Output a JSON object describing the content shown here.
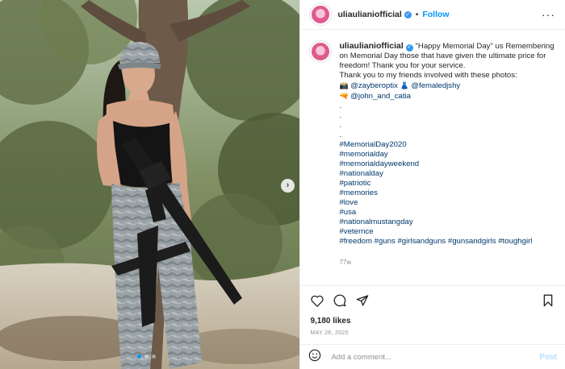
{
  "header": {
    "username": "uliaulianiofficial",
    "separator": "•",
    "follow_label": "Follow",
    "more_label": "···"
  },
  "caption": {
    "username": "uliaulianiofficial",
    "lines": [
      "\"Happy Memorial Day\" us Remembering on Memorial Day those that have given the ultimate price for freedom! Thank you for your service.",
      "Thank you to my friends involved with these photos:"
    ],
    "credit1_prefix_icon": "📸",
    "credit1_user1": "@zayberoptix",
    "credit1_mid_icon": "👗",
    "credit1_user2": "@femaledjshy",
    "credit2_icon": "🔫",
    "credit2_user": "@john_and_catia",
    "dots": [
      ".",
      ".",
      ".",
      "."
    ],
    "hashtags": [
      "#MemorialDay2020",
      "#memorialday",
      "#memorialdayweekend",
      "#nationalday",
      "#patriotic",
      "#memories",
      "#love",
      "#usa",
      "#nationalmustangday",
      "#veternce"
    ],
    "last_tags": "#freedom #guns #girlsandguns #gunsandgirls #toughgirl",
    "time": "77w"
  },
  "stats": {
    "likes": "9,180 likes",
    "date": "MAY 26, 2020"
  },
  "comment": {
    "placeholder": "Add a comment...",
    "post_label": "Post"
  },
  "icons": {
    "like": "heart-icon",
    "comment": "comment-icon",
    "share": "share-icon",
    "save": "bookmark-icon",
    "emoji": "emoji-icon",
    "next": "chevron-right-icon"
  },
  "colors": {
    "link": "#00376b",
    "follow": "#0095f6",
    "muted": "#8e8e8e",
    "post_disabled": "#b2dffc"
  }
}
